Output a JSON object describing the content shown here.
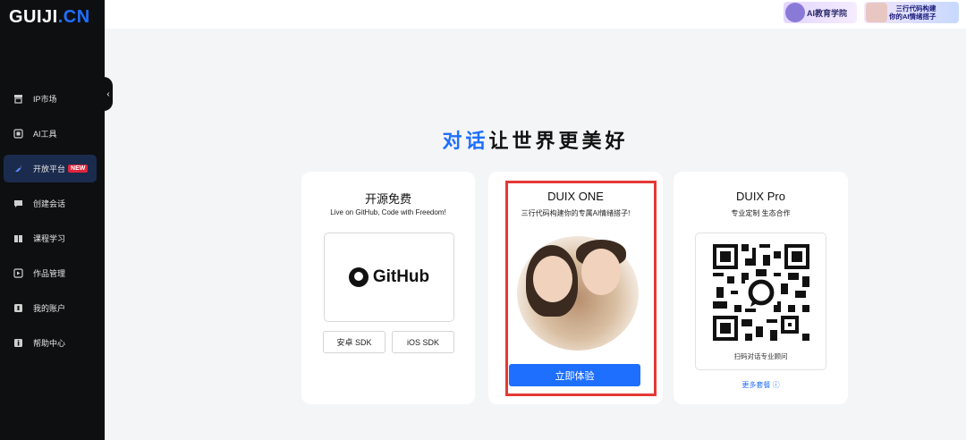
{
  "brand": {
    "logo_main": "GUIJI",
    "logo_dot": ".CN"
  },
  "sidebar": {
    "collapse_icon": "chevron-left-icon",
    "items": [
      {
        "label": "IP市场",
        "icon": "store-icon"
      },
      {
        "label": "AI工具",
        "icon": "toolbox-icon"
      },
      {
        "label": "开放平台",
        "icon": "rocket-icon",
        "badge": "NEW",
        "active": true
      },
      {
        "label": "创建会话",
        "icon": "chat-icon"
      },
      {
        "label": "课程学习",
        "icon": "book-icon"
      },
      {
        "label": "作品管理",
        "icon": "folder-icon"
      },
      {
        "label": "我的账户",
        "icon": "account-icon"
      },
      {
        "label": "帮助中心",
        "icon": "help-icon"
      }
    ]
  },
  "topbar": {
    "banner_1": "AI教育学院",
    "banner_2_line_1": "三行代码构建",
    "banner_2_line_2": "你的AI情绪搭子"
  },
  "headline": {
    "blue_part": "对话",
    "black_part": "让世界更美好"
  },
  "cards": {
    "open_source": {
      "title": "开源免费",
      "subtitle": "Live on GitHub, Code with Freedom!",
      "github_word": "GitHub",
      "android_sdk": "安卓 SDK",
      "ios_sdk": "iOS SDK"
    },
    "duix_one": {
      "title": "DUIX ONE",
      "subtitle": "三行代码构建你的专属AI情绪搭子!",
      "cta": "立即体验"
    },
    "duix_pro": {
      "title": "DUIX Pro",
      "subtitle": "专业定制 生态合作",
      "qr_caption": "扫码对话专业顾问",
      "more_link": "更多套餐 ⓘ"
    }
  },
  "colors": {
    "accent": "#1f6fff",
    "sidebar_bg": "#0e0f11",
    "highlight_frame": "#e53935",
    "badge": "#e0243c"
  }
}
